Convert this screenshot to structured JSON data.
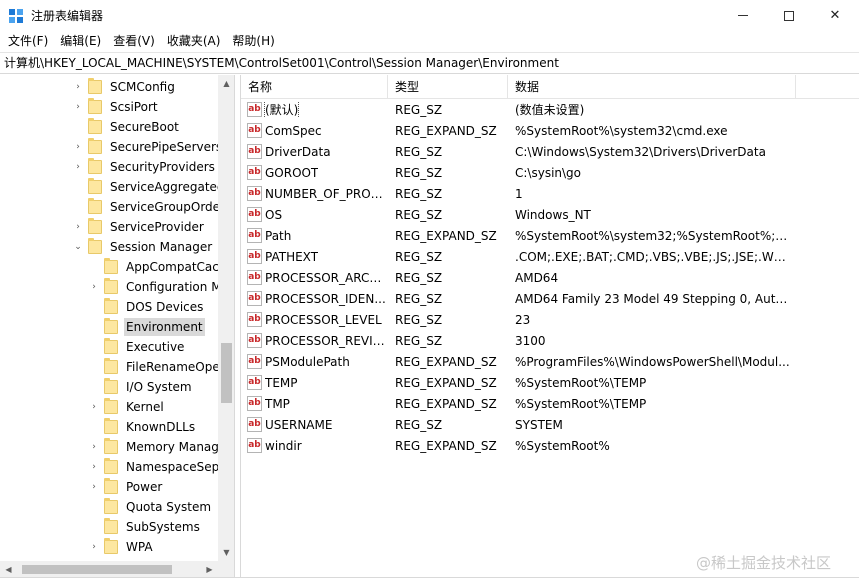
{
  "window": {
    "title": "注册表编辑器",
    "icon": "registry-editor-icon",
    "controls": {
      "minimize": "minimize-icon",
      "maximize": "maximize-icon",
      "close": "✕"
    }
  },
  "menu": [
    "文件(F)",
    "编辑(E)",
    "查看(V)",
    "收藏夹(A)",
    "帮助(H)"
  ],
  "address": "计算机\\HKEY_LOCAL_MACHINE\\SYSTEM\\ControlSet001\\Control\\Session Manager\\Environment",
  "tree": {
    "items": [
      {
        "label": "SCMConfig",
        "level": 1,
        "expander": "›"
      },
      {
        "label": "ScsiPort",
        "level": 1,
        "expander": "›"
      },
      {
        "label": "SecureBoot",
        "level": 1,
        "expander": ""
      },
      {
        "label": "SecurePipeServers",
        "level": 1,
        "expander": "›"
      },
      {
        "label": "SecurityProviders",
        "level": 1,
        "expander": "›"
      },
      {
        "label": "ServiceAggregated",
        "level": 1,
        "expander": ""
      },
      {
        "label": "ServiceGroupOrde",
        "level": 1,
        "expander": ""
      },
      {
        "label": "ServiceProvider",
        "level": 1,
        "expander": "›"
      },
      {
        "label": "Session Manager",
        "level": 1,
        "expander": "⌄"
      },
      {
        "label": "AppCompatCacl",
        "level": 2,
        "expander": ""
      },
      {
        "label": "Configuration M",
        "level": 2,
        "expander": "›"
      },
      {
        "label": "DOS Devices",
        "level": 2,
        "expander": ""
      },
      {
        "label": "Environment",
        "level": 2,
        "expander": "",
        "selected": true
      },
      {
        "label": "Executive",
        "level": 2,
        "expander": ""
      },
      {
        "label": "FileRenameOpe",
        "level": 2,
        "expander": ""
      },
      {
        "label": "I/O System",
        "level": 2,
        "expander": ""
      },
      {
        "label": "Kernel",
        "level": 2,
        "expander": "›"
      },
      {
        "label": "KnownDLLs",
        "level": 2,
        "expander": ""
      },
      {
        "label": "Memory Manag",
        "level": 2,
        "expander": "›"
      },
      {
        "label": "NamespaceSepa",
        "level": 2,
        "expander": "›"
      },
      {
        "label": "Power",
        "level": 2,
        "expander": "›"
      },
      {
        "label": "Quota System",
        "level": 2,
        "expander": ""
      },
      {
        "label": "SubSystems",
        "level": 2,
        "expander": ""
      },
      {
        "label": "WPA",
        "level": 2,
        "expander": "›"
      }
    ],
    "scroll_up": "▲",
    "scroll_down": "▼",
    "scroll_left": "◀",
    "scroll_right": "▶"
  },
  "list": {
    "columns": [
      "名称",
      "类型",
      "数据"
    ],
    "value_icon": "ab",
    "rows": [
      {
        "name": "(默认)",
        "type": "REG_SZ",
        "data": "(数值未设置)"
      },
      {
        "name": "ComSpec",
        "type": "REG_EXPAND_SZ",
        "data": "%SystemRoot%\\system32\\cmd.exe"
      },
      {
        "name": "DriverData",
        "type": "REG_SZ",
        "data": "C:\\Windows\\System32\\Drivers\\DriverData"
      },
      {
        "name": "GOROOT",
        "type": "REG_SZ",
        "data": "C:\\sysin\\go"
      },
      {
        "name": "NUMBER_OF_PROC...",
        "type": "REG_SZ",
        "data": "1"
      },
      {
        "name": "OS",
        "type": "REG_SZ",
        "data": "Windows_NT"
      },
      {
        "name": "Path",
        "type": "REG_EXPAND_SZ",
        "data": "%SystemRoot%\\system32;%SystemRoot%;%S..."
      },
      {
        "name": "PATHEXT",
        "type": "REG_SZ",
        "data": ".COM;.EXE;.BAT;.CMD;.VBS;.VBE;.JS;.JSE;.WSF;..."
      },
      {
        "name": "PROCESSOR_ARCH...",
        "type": "REG_SZ",
        "data": "AMD64"
      },
      {
        "name": "PROCESSOR_IDEN...",
        "type": "REG_SZ",
        "data": "AMD64 Family 23 Model 49 Stepping 0, Auth..."
      },
      {
        "name": "PROCESSOR_LEVEL",
        "type": "REG_SZ",
        "data": "23"
      },
      {
        "name": "PROCESSOR_REVIS...",
        "type": "REG_SZ",
        "data": "3100"
      },
      {
        "name": "PSModulePath",
        "type": "REG_EXPAND_SZ",
        "data": "%ProgramFiles%\\WindowsPowerShell\\Modul..."
      },
      {
        "name": "TEMP",
        "type": "REG_EXPAND_SZ",
        "data": "%SystemRoot%\\TEMP"
      },
      {
        "name": "TMP",
        "type": "REG_EXPAND_SZ",
        "data": "%SystemRoot%\\TEMP"
      },
      {
        "name": "USERNAME",
        "type": "REG_SZ",
        "data": "SYSTEM"
      },
      {
        "name": "windir",
        "type": "REG_EXPAND_SZ",
        "data": "%SystemRoot%"
      }
    ]
  },
  "watermark": "@稀土掘金技术社区"
}
